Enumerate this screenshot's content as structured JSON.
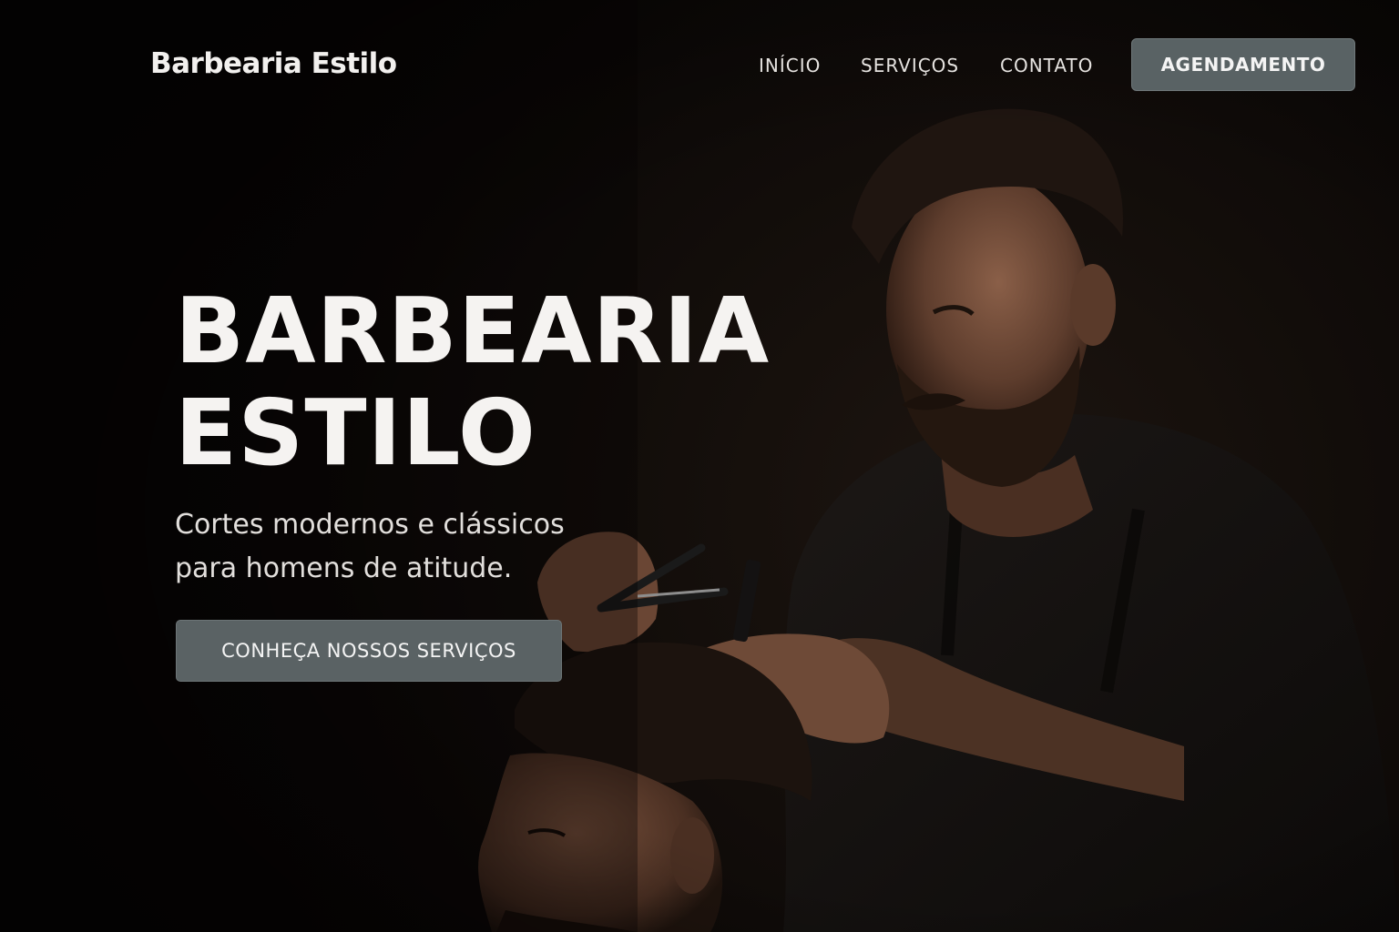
{
  "header": {
    "brand": "Barbearia Estilo",
    "nav": {
      "inicio": "INÍCIO",
      "servicos": "SERVIÇOS",
      "contato": "CONTATO"
    },
    "cta": "AGENDAMENTO"
  },
  "hero": {
    "title_line1": "BARBEARIA",
    "title_line2": "ESTILO",
    "subtitle_line1": "Cortes modernos e clássicos",
    "subtitle_line2": "para homens de atitude.",
    "cta": "CONHEÇA NOSSOS SERVIÇOS",
    "image": "barber-cutting-hair-photo"
  },
  "colors": {
    "background": "#0b0807",
    "button": "#596264",
    "text": "#f5f3f1"
  }
}
